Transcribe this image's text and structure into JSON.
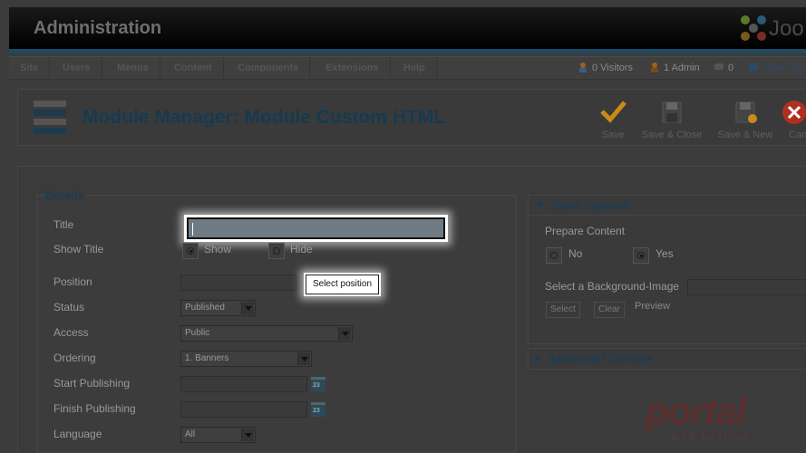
{
  "header": {
    "title": "Administration",
    "logo_text": "Joo"
  },
  "menu": {
    "items": [
      "Site",
      "Users",
      "Menus",
      "Content",
      "Components",
      "Extensions",
      "Help"
    ],
    "status": {
      "visitors": "0 Visitors",
      "admins": "1 Admin",
      "messages": "0",
      "view_site": "View Site"
    }
  },
  "toolbar": {
    "title": "Module Manager: Module Custom HTML",
    "buttons": {
      "save": "Save",
      "save_close": "Save & Close",
      "save_new": "Save & New",
      "cancel": "Can"
    }
  },
  "details": {
    "legend": "Details",
    "labels": {
      "title": "Title",
      "title_required": "*",
      "show_title": "Show Title",
      "position": "Position",
      "status": "Status",
      "access": "Access",
      "ordering": "Ordering",
      "start_publishing": "Start Publishing",
      "finish_publishing": "Finish Publishing",
      "language": "Language"
    },
    "show_title_options": {
      "show": "Show",
      "hide": "Hide"
    },
    "select_position_button": "Select position",
    "status_value": "Published",
    "access_value": "Public",
    "ordering_value": "1. Banners",
    "language_value": "All",
    "calendar_label": "23"
  },
  "basic_options": {
    "heading": "Basic Options",
    "prepare_content": "Prepare Content",
    "no": "No",
    "yes": "Yes",
    "background_image": "Select a Background-Image",
    "select": "Select",
    "clear": "Clear",
    "preview": "Preview"
  },
  "advanced_options": {
    "heading": "Advanced Options"
  },
  "watermark": {
    "word": "portal",
    "sub": "web hosting"
  },
  "colors": {
    "accent": "#1c3d55",
    "header_bg": "#000000",
    "save_check": "#c98a1a",
    "cancel_red": "#b03020"
  }
}
